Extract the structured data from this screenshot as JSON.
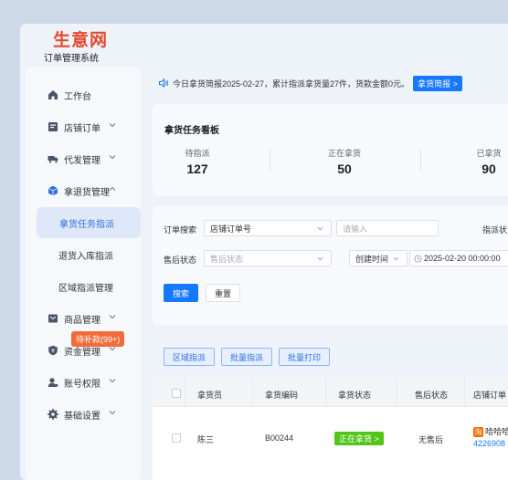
{
  "logo": {
    "main": "生意网",
    "sub": "订单管理系统"
  },
  "sidebar": {
    "items": [
      {
        "label": "工作台",
        "icon": "home-icon"
      },
      {
        "label": "店铺订单",
        "icon": "store-orders-icon"
      },
      {
        "label": "代发管理",
        "icon": "truck-icon"
      },
      {
        "label": "拿退货管理",
        "icon": "cube-icon"
      },
      {
        "label": "拿货任务指派",
        "sub": true,
        "active": true
      },
      {
        "label": "退货入库指派",
        "sub": true
      },
      {
        "label": "区域指派管理",
        "sub": true
      },
      {
        "label": "商品管理",
        "icon": "goods-icon"
      },
      {
        "label": "资金管理",
        "icon": "shield-icon"
      },
      {
        "label": "账号权限",
        "icon": "user-icon"
      },
      {
        "label": "基础设置",
        "icon": "gear-icon"
      }
    ],
    "badge": "待补款(99+)"
  },
  "notice": {
    "text": "今日拿货简报2025-02-27，累计指派拿货量27件，货款金额0元。",
    "button": "拿货简报 >"
  },
  "board": {
    "title": "拿货任务看板",
    "stats": [
      {
        "label": "待指派",
        "value": "127"
      },
      {
        "label": "正在拿货",
        "value": "50"
      },
      {
        "label": "已拿货",
        "value": "90"
      }
    ]
  },
  "filters": {
    "order_search_label": "订单搜索",
    "order_search_select": "店铺订单号",
    "order_search_placeholder": "请输入",
    "assign_status_label": "指派状",
    "after_sale_label": "售后状态",
    "after_sale_placeholder": "售后状态",
    "time_select": "创建时间",
    "date_value": "2025-02-20 00:00:00",
    "search_button": "搜索",
    "reset_button": "重置"
  },
  "actions": {
    "region_assign": "区域指派",
    "batch_assign": "批量指派",
    "batch_print": "批量打印"
  },
  "table": {
    "headers": [
      "拿货员",
      "拿货编码",
      "拿货状态",
      "售后状态",
      "店铺订单"
    ],
    "rows": [
      {
        "picker": "陈三",
        "code": "B00244",
        "status": "正在拿货 >",
        "after_sale": "无售后",
        "store_name": "哈哈哈",
        "store_order": "4226908"
      }
    ]
  },
  "colors": {
    "primary": "#1677ff",
    "green": "#52c41a",
    "badge": "#f26b3a",
    "logo": "#e64a2e"
  }
}
